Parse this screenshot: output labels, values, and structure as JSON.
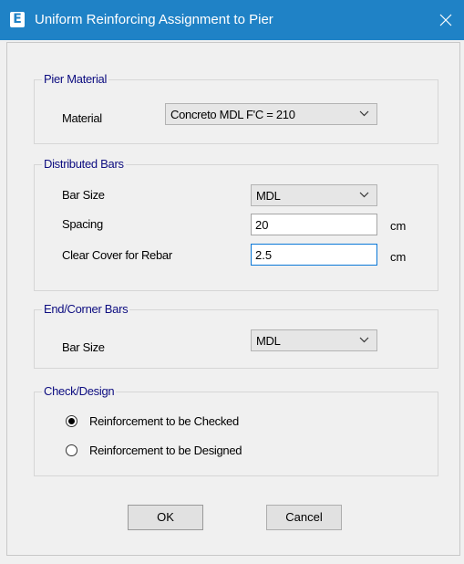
{
  "window": {
    "app_icon": "E",
    "title": "Uniform Reinforcing Assignment to Pier"
  },
  "pier_material": {
    "legend": "Pier Material",
    "material_label": "Material",
    "material_value": "Concreto MDL F'C = 210"
  },
  "distributed_bars": {
    "legend": "Distributed Bars",
    "bar_size_label": "Bar Size",
    "bar_size_value": "MDL",
    "spacing_label": "Spacing",
    "spacing_value": "20",
    "spacing_unit": "cm",
    "clear_cover_label": "Clear Cover for Rebar",
    "clear_cover_value": "2.5",
    "clear_cover_unit": "cm"
  },
  "end_corner_bars": {
    "legend": "End/Corner Bars",
    "bar_size_label": "Bar Size",
    "bar_size_value": "MDL"
  },
  "check_design": {
    "legend": "Check/Design",
    "options": [
      {
        "label": "Reinforcement to be Checked",
        "checked": true
      },
      {
        "label": "Reinforcement to be Designed",
        "checked": false
      }
    ]
  },
  "buttons": {
    "ok": "OK",
    "cancel": "Cancel"
  },
  "colors": {
    "titlebar": "#1f82c6",
    "legend_text": "#0d0d80",
    "focus_border": "#0a78d7"
  }
}
